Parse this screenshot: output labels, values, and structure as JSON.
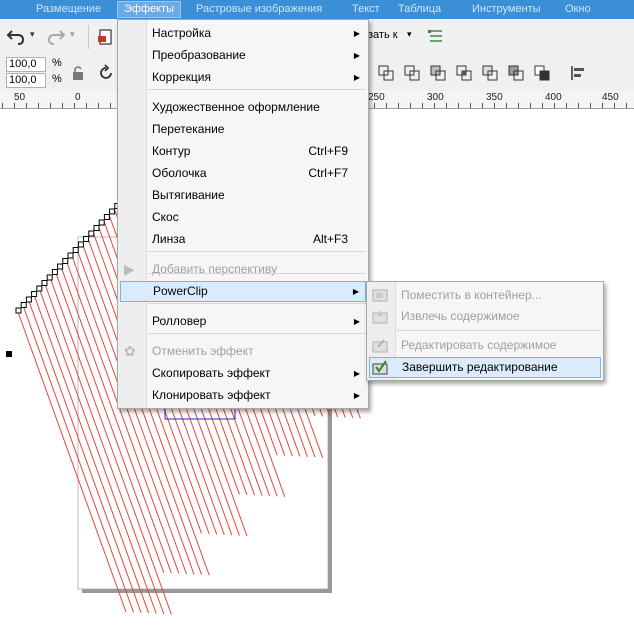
{
  "menubar": {
    "items": [
      "Размещение",
      "Эффекты",
      "Растровые изображения",
      "Текст",
      "Таблица",
      "Инструменты",
      "Окно"
    ]
  },
  "toolbar": {
    "size_w": "100,0",
    "size_h": "100,0",
    "unit_w": "%",
    "unit_h": "%",
    "snap_label": "азать к",
    "dropdown_arrow": "▾"
  },
  "ruler": {
    "labels": [
      "50",
      "0",
      "250",
      "300",
      "350",
      "400",
      "450"
    ]
  },
  "effects_menu": {
    "items": [
      {
        "label": "Настройка",
        "underline": "Н",
        "rest": "астройка",
        "shortcut": "",
        "submenu": true,
        "disabled": false
      },
      {
        "label": "Преобразование",
        "underline": "П",
        "rest": "реобразование",
        "shortcut": "",
        "submenu": true,
        "disabled": false
      },
      {
        "label": "Коррекция",
        "underline": "К",
        "rest": "оррекция",
        "shortcut": "",
        "submenu": true,
        "disabled": false
      },
      {
        "label": "Художественное оформление",
        "underline": "Х",
        "rest": "удожественное оформление",
        "shortcut": "",
        "submenu": false,
        "disabled": false
      },
      {
        "label": "Перетекание",
        "underline": "П",
        "rest": "еретекание",
        "shortcut": "",
        "submenu": false,
        "disabled": false
      },
      {
        "label": "Контур",
        "underline": "",
        "rest": "Контур",
        "shortcut": "Ctrl+F9",
        "submenu": false,
        "disabled": false
      },
      {
        "label": "Оболочка",
        "underline": "О",
        "rest": "болочка",
        "shortcut": "Ctrl+F7",
        "submenu": false,
        "disabled": false
      },
      {
        "label": "Вытягивание",
        "underline": "В",
        "rest": "ытягивание",
        "shortcut": "",
        "submenu": false,
        "disabled": false
      },
      {
        "label": "Скос",
        "underline": "С",
        "rest": "кос",
        "shortcut": "",
        "submenu": false,
        "disabled": false
      },
      {
        "label": "Линза",
        "underline": "Л",
        "rest": "инза",
        "shortcut": "Alt+F3",
        "submenu": false,
        "disabled": false
      },
      {
        "label": "Добавить перспективу",
        "underline": "Д",
        "rest": "обавить перспективу",
        "shortcut": "",
        "submenu": false,
        "disabled": true
      },
      {
        "label": "PowerClip",
        "underline": "",
        "rest": "PowerClip",
        "shortcut": "",
        "submenu": true,
        "disabled": false
      },
      {
        "label": "Ролловер",
        "underline": "Р",
        "rest": "олловер",
        "shortcut": "",
        "submenu": true,
        "disabled": false
      },
      {
        "label": "Отменить эффект",
        "underline": "",
        "rest": "Отменить эффект",
        "shortcut": "",
        "submenu": false,
        "disabled": true
      },
      {
        "label": "Скопировать эффект",
        "underline": "С",
        "rest": "копировать эффект",
        "shortcut": "",
        "submenu": true,
        "disabled": false
      },
      {
        "label": "Клонировать эффект",
        "underline": "",
        "rest": "Клонировать эффект",
        "shortcut": "",
        "submenu": true,
        "disabled": false
      }
    ]
  },
  "powerclip_menu": {
    "items": [
      {
        "label": "Поместить в контейнер...",
        "disabled": true,
        "icon": "place-in-container-icon"
      },
      {
        "label": "Извлечь содержимое",
        "disabled": true,
        "icon": "extract-contents-icon"
      },
      {
        "label": "Редактировать содержимое",
        "disabled": true,
        "icon": "edit-contents-icon"
      },
      {
        "label": "Завершить редактирование",
        "disabled": false,
        "icon": "finish-editing-icon"
      }
    ]
  },
  "colors": {
    "menubar": "#3b8fd6",
    "highlight": "#dcebfb",
    "highlight_border": "#7fb1e6",
    "hatch_lines": "#e8463a",
    "disabled_text": "#a0a0a0"
  }
}
